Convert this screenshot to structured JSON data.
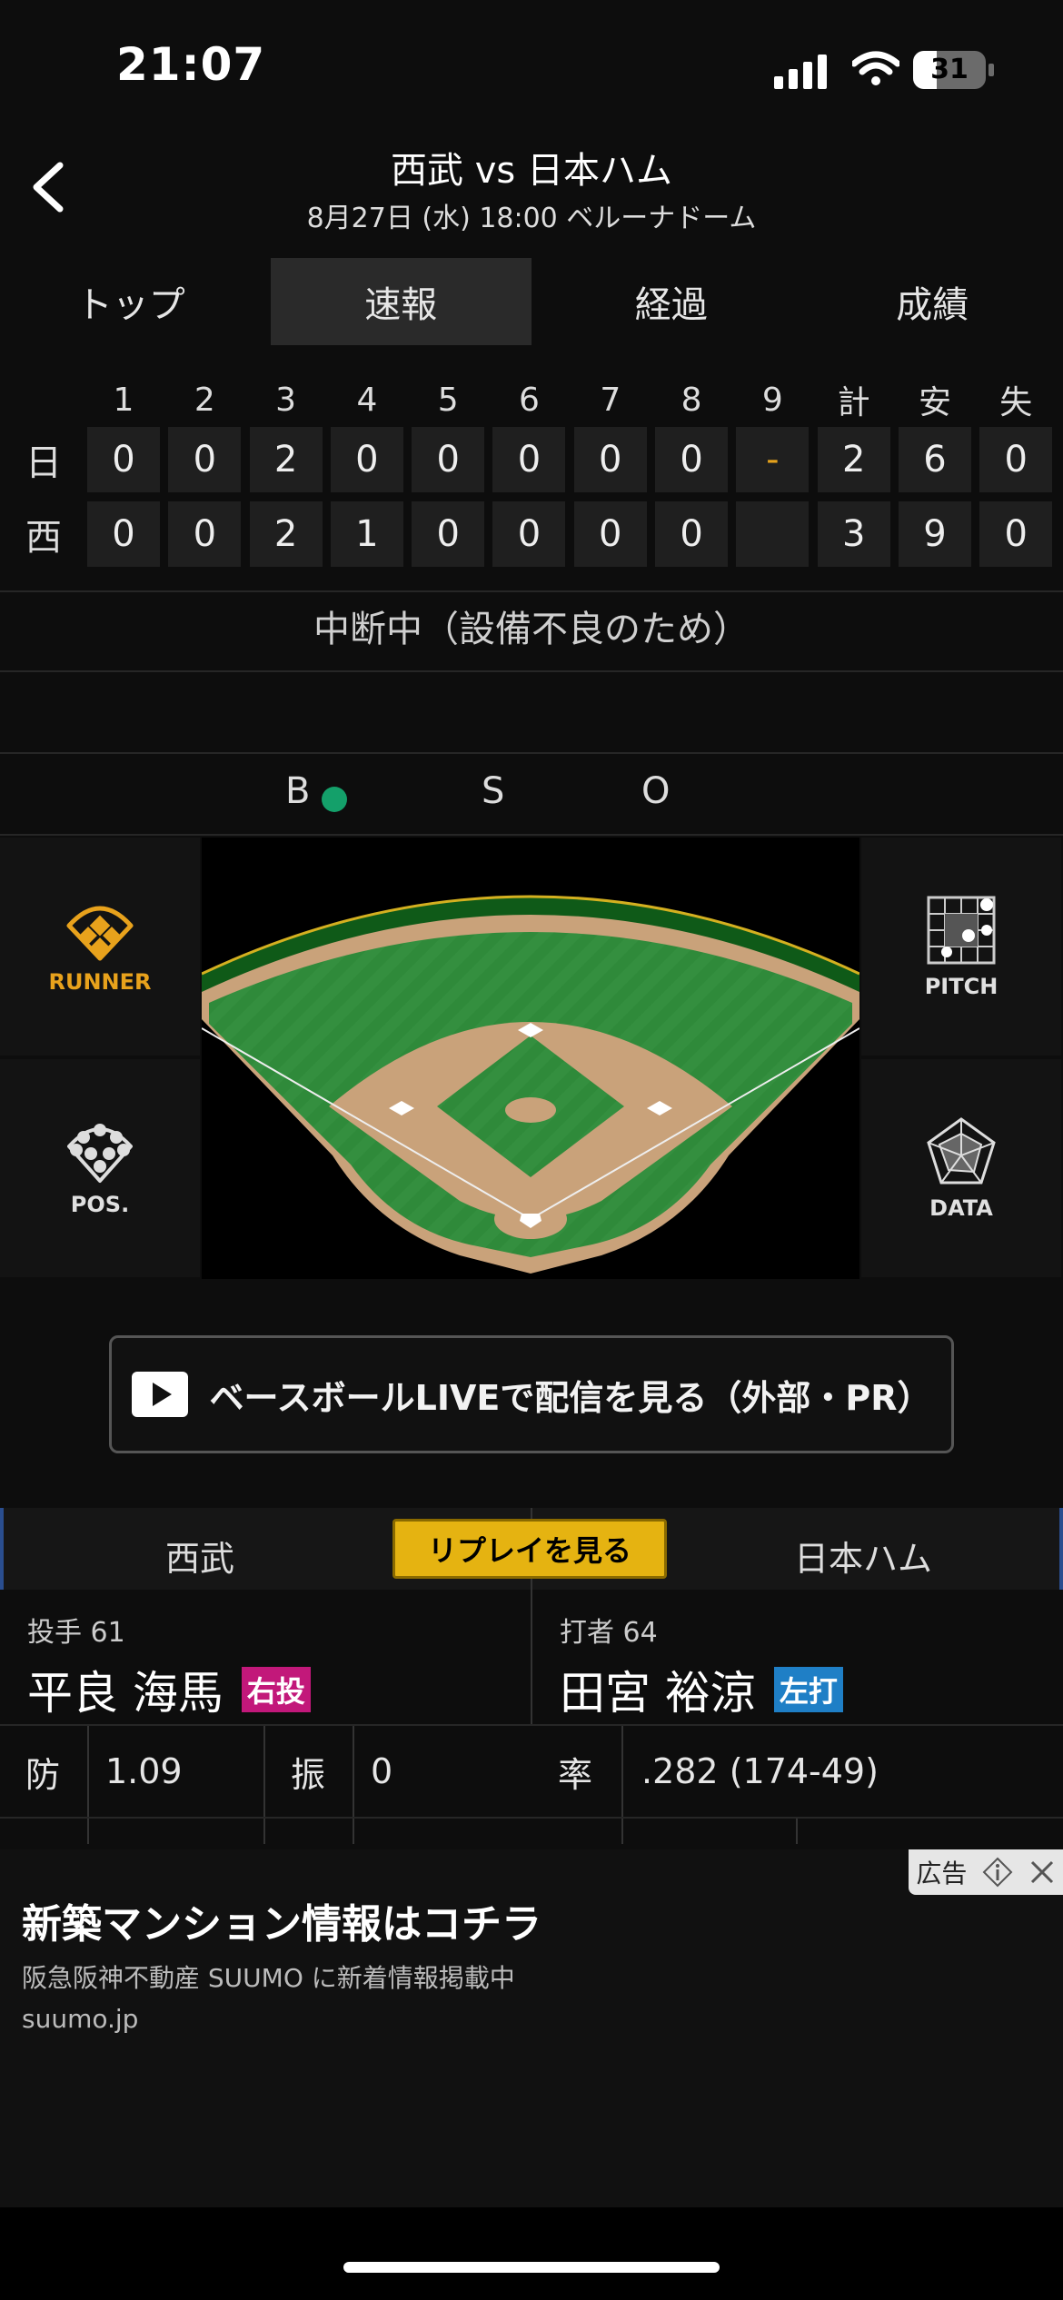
{
  "status_bar": {
    "time": "21:07",
    "battery": "31"
  },
  "header": {
    "title": "西武 vs 日本ハム",
    "subtitle": "8月27日 (水) 18:00 ベルーナドーム"
  },
  "tabs": [
    {
      "label": "トップ",
      "active": false
    },
    {
      "label": "速報",
      "active": true
    },
    {
      "label": "経過",
      "active": false
    },
    {
      "label": "成績",
      "active": false
    }
  ],
  "scoreboard": {
    "headers": [
      "1",
      "2",
      "3",
      "4",
      "5",
      "6",
      "7",
      "8",
      "9",
      "計",
      "安",
      "失"
    ],
    "rows": [
      {
        "team": "日",
        "cells": [
          "0",
          "0",
          "2",
          "0",
          "0",
          "0",
          "0",
          "0",
          "-",
          "2",
          "6",
          "0"
        ]
      },
      {
        "team": "西",
        "cells": [
          "0",
          "0",
          "2",
          "1",
          "0",
          "0",
          "0",
          "0",
          "",
          "3",
          "9",
          "0"
        ]
      }
    ]
  },
  "game_status": "中断中（設備不良のため）",
  "count": {
    "ball_label": "B",
    "strike_label": "S",
    "out_label": "O",
    "balls": 1,
    "strikes": 0,
    "outs": 0
  },
  "side_buttons": {
    "runner": "RUNNER",
    "pos": "POS.",
    "pitch": "PITCH",
    "data": "DATA"
  },
  "cta": {
    "label": "ベースボールLIVEで配信を見る（外部・PR）"
  },
  "team_bar": {
    "left": "西武",
    "right": "日本ハム",
    "replay": "リプレイを見る"
  },
  "pitcher": {
    "role": "投手 61",
    "name": "平良 海馬",
    "badge": "右投",
    "badge_color": "#c2187a"
  },
  "batter": {
    "role": "打者 64",
    "name": "田宮 裕涼",
    "badge": "左打",
    "badge_color": "#1f7fc6"
  },
  "stats": {
    "era_label": "防",
    "era": "1.09",
    "so_label": "振",
    "so": "0",
    "avg_label": "率",
    "avg": ".282 (174-49)"
  },
  "ad": {
    "tag": "広告",
    "title": "新築マンション情報はコチラ",
    "desc": "阪急阪神不動産 SUUMO に新着情報掲載中",
    "url": "suumo.jp"
  },
  "colors": {
    "accent": "#e5b311",
    "ball_dot": "#14a06a",
    "dash": "#e5a21c"
  }
}
